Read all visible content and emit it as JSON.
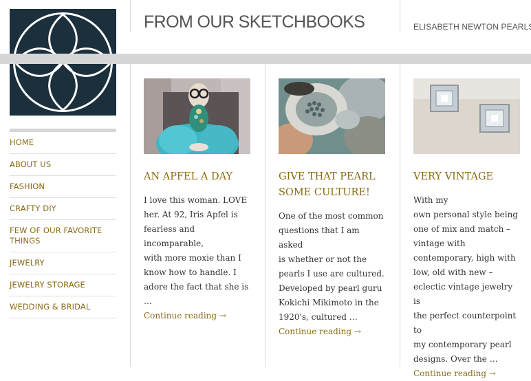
{
  "header": {
    "site_title": "FROM OUR SKETCHBOOKS",
    "site_name": "ELISABETH NEWTON PEARLS"
  },
  "sidebar": {
    "items": [
      {
        "label": "HOME"
      },
      {
        "label": "ABOUT US"
      },
      {
        "label": "FASHION"
      },
      {
        "label": "CRAFTY DIY"
      },
      {
        "label": "FEW OF OUR FAVORITE THINGS"
      },
      {
        "label": "JEWELRY"
      },
      {
        "label": "JEWELRY STORAGE"
      },
      {
        "label": "WEDDING & BRIDAL"
      }
    ]
  },
  "posts": [
    {
      "title": "AN APFEL A DAY",
      "excerpt": "I love this woman. LOVE\nher. At 92, Iris Apfel is\nfearless and incomparable,\nwith more moxie than I\nknow how to handle. I\nadore the fact that she is …",
      "more": "Continue reading →"
    },
    {
      "title": "GIVE THAT PEARL SOME CULTURE!",
      "excerpt": "One of the most common\nquestions that I am asked\nis whether or not the\npearls I use are cultured.\nDeveloped by pearl guru\nKokichi Mikimoto in the\n1920's, cultured …",
      "more": "Continue reading →"
    },
    {
      "title": "VERY VINTAGE",
      "excerpt": "With my\nown personal style being\none of mix and match –\nvintage with\ncontemporary, high with\nlow, old with new –\neclectic vintage jewelry is\nthe perfect counterpoint to\nmy contemporary pearl\ndesigns. Over the …",
      "more": "Continue reading →"
    }
  ],
  "colors": {
    "accent": "#8a6a14",
    "logo_bg": "#1b2f3d",
    "band": "#d6d6d6"
  }
}
